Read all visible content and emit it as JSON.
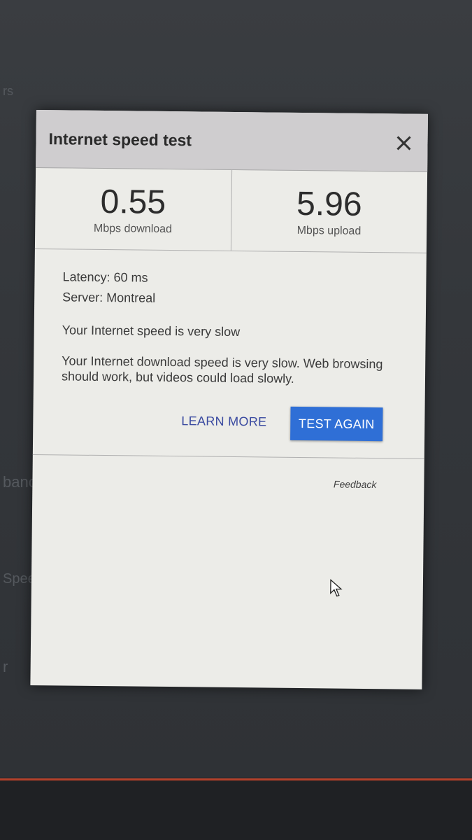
{
  "dialog": {
    "title": "Internet speed test",
    "close_icon": "close-icon"
  },
  "stats": {
    "download_value": "0.55",
    "download_unit": "Mbps download",
    "upload_value": "5.96",
    "upload_unit": "Mbps upload"
  },
  "details": {
    "latency": "Latency: 60 ms",
    "server": "Server: Montreal",
    "summary": "Your Internet speed is very slow",
    "description": "Your Internet download speed is very slow. Web browsing should work, but videos could load slowly."
  },
  "actions": {
    "learn_more": "LEARN MORE",
    "test_again": "TEST AGAIN"
  },
  "footer": {
    "feedback": "Feedback"
  },
  "colors": {
    "primary_button": "#2f6fd6",
    "link": "#3a4aa0"
  }
}
